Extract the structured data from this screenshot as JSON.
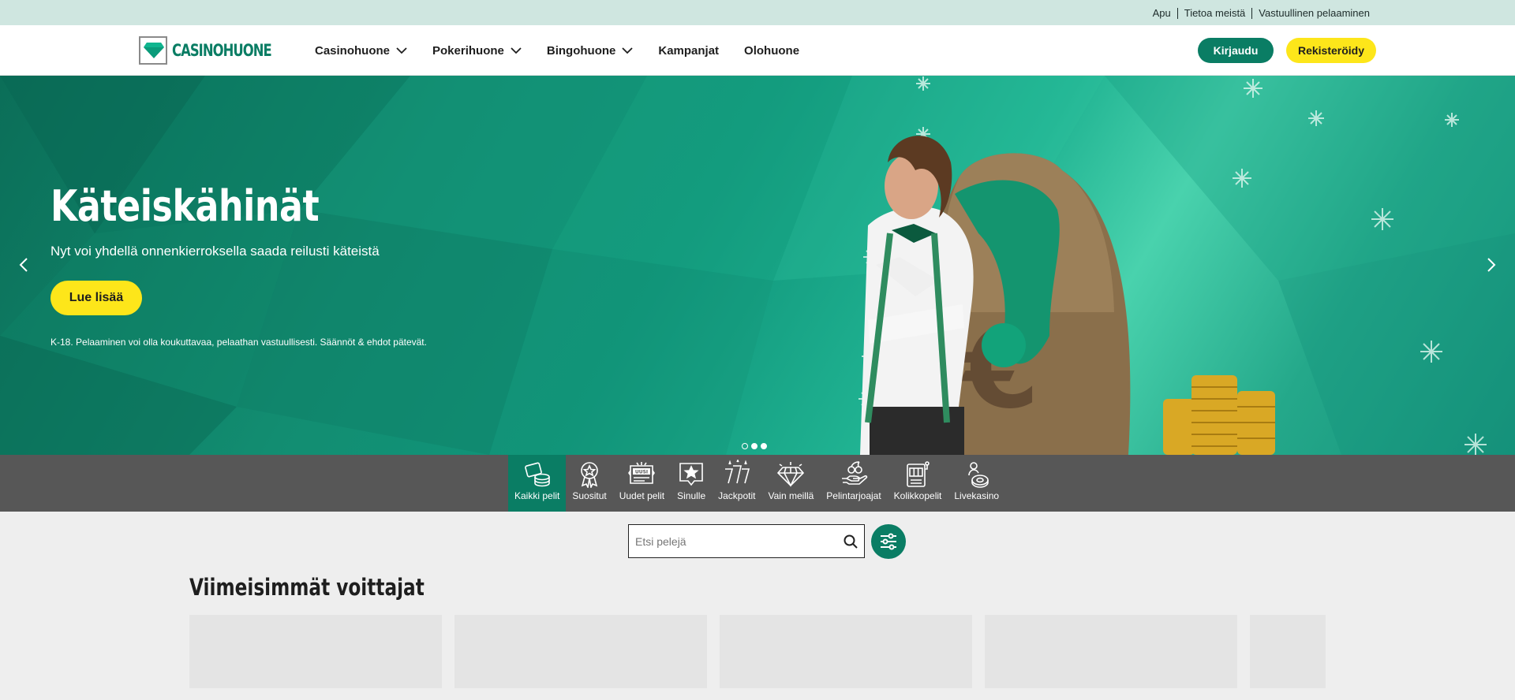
{
  "utility": {
    "links": [
      "Apu",
      "Tietoa meistä",
      "Vastuullinen pelaaminen"
    ]
  },
  "header": {
    "logo_text": "CASINOHUONE",
    "nav": [
      {
        "label": "Casinohuone",
        "dropdown": true
      },
      {
        "label": "Pokerihuone",
        "dropdown": true
      },
      {
        "label": "Bingohuone",
        "dropdown": true
      },
      {
        "label": "Kampanjat",
        "dropdown": false
      },
      {
        "label": "Olohuone",
        "dropdown": false
      }
    ],
    "login_label": "Kirjaudu",
    "register_label": "Rekisteröidy"
  },
  "hero": {
    "title": "Käteiskähinät",
    "subtitle": "Nyt voi yhdellä onnenkierroksella saada reilusti käteistä",
    "cta_label": "Lue lisää",
    "disclaimer": "K-18. Pelaaminen voi olla koukuttavaa, pelaathan vastuullisesti. Säännöt & ehdot pätevät.",
    "slides_total": 3,
    "active_slide": 1
  },
  "categories": [
    {
      "label": "Kaikki pelit",
      "icon": "chips-icon",
      "active": true
    },
    {
      "label": "Suositut",
      "icon": "award-icon",
      "active": false
    },
    {
      "label": "Uudet pelit",
      "icon": "new-badge-icon",
      "badge": "UUSI",
      "active": false
    },
    {
      "label": "Sinulle",
      "icon": "star-bubble-icon",
      "active": false
    },
    {
      "label": "Jackpotit",
      "icon": "sevens-icon",
      "active": false
    },
    {
      "label": "Vain meillä",
      "icon": "diamond-icon",
      "active": false
    },
    {
      "label": "Pelintarjoajat",
      "icon": "hand-cherries-icon",
      "active": false
    },
    {
      "label": "Kolikkopelit",
      "icon": "slot-machine-icon",
      "active": false
    },
    {
      "label": "Livekasino",
      "icon": "live-dealer-icon",
      "active": false
    }
  ],
  "search": {
    "placeholder": "Etsi pelejä"
  },
  "winners": {
    "title": "Viimeisimmät voittajat"
  },
  "colors": {
    "brand": "#0a7d64",
    "accent": "#fde61a",
    "utility_bg": "#cfe6e0",
    "category_bar": "#575757"
  }
}
